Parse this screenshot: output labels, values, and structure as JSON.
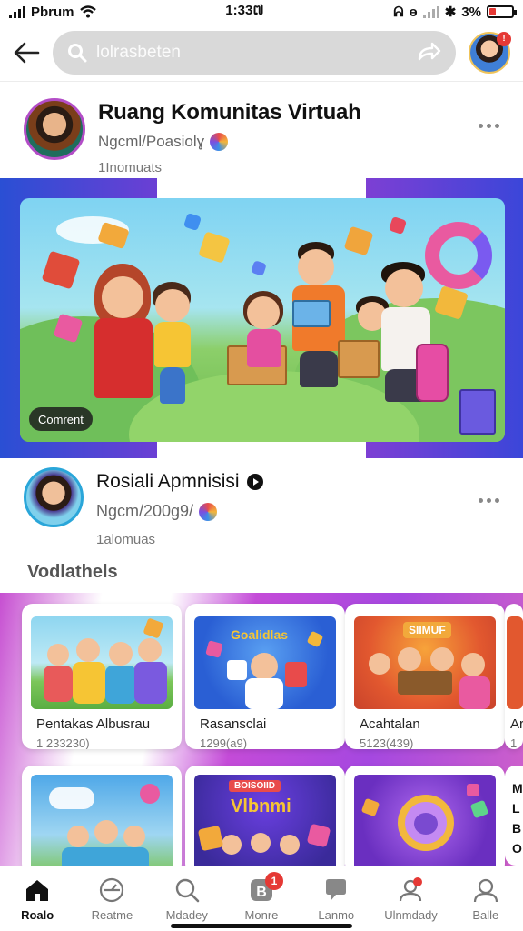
{
  "status_bar": {
    "carrier": "Pbrum",
    "time": "1:33៧",
    "battery_text": "3%",
    "battery_level": 0.3,
    "alarm": "ᕱ",
    "misc": "ɵ"
  },
  "top_bar": {
    "search_placeholder": "lolrasbeten",
    "notif_count": "!"
  },
  "community": {
    "title": "Ruang Komunitas Virtuah",
    "subtitle": "Ngcml/Poasiolɣ",
    "meta": "1Inomuats"
  },
  "hero": {
    "tag": "Comrent"
  },
  "post2": {
    "title": "Rosiali Apmnisisi",
    "subtitle": "Ngcm/200ɡ9/",
    "meta": "1alomuas"
  },
  "section": {
    "title": "Vodlathels"
  },
  "cards": [
    {
      "title": "Pentakas Albusrau",
      "count": "1 233230)"
    },
    {
      "title": "Rasansclai",
      "count": "1299(a9)"
    },
    {
      "title": "Acahtalan",
      "count": "5123(439)"
    },
    {
      "title": "Ar",
      "count": "1"
    }
  ],
  "card_art_titles": [
    {
      "caption": "Goalidlas"
    },
    {
      "caption": "SIIMUF"
    },
    {
      "caption": "Vlbnmi",
      "sub": "BOISOIID"
    },
    {
      "caption": "M L B O"
    }
  ],
  "bottom_nav": [
    {
      "label": "Roalo",
      "icon": "home-icon",
      "active": true
    },
    {
      "label": "Reatme",
      "icon": "compass-icon",
      "active": false
    },
    {
      "label": "Mdadey",
      "icon": "search-icon",
      "active": false
    },
    {
      "label": "Monre",
      "icon": "inbox-icon",
      "active": false,
      "badge": "1"
    },
    {
      "label": "Lanmo",
      "icon": "chat-icon",
      "active": false
    },
    {
      "label": "Ulnmdady",
      "icon": "profile-alert-icon",
      "active": false
    },
    {
      "label": "Balle",
      "icon": "user-icon",
      "active": false
    }
  ],
  "colors": {
    "accent_purple": "#a548e0",
    "accent_blue": "#2a4fd4",
    "notif_red": "#e53935",
    "search_pill": "#d9d9d9"
  }
}
